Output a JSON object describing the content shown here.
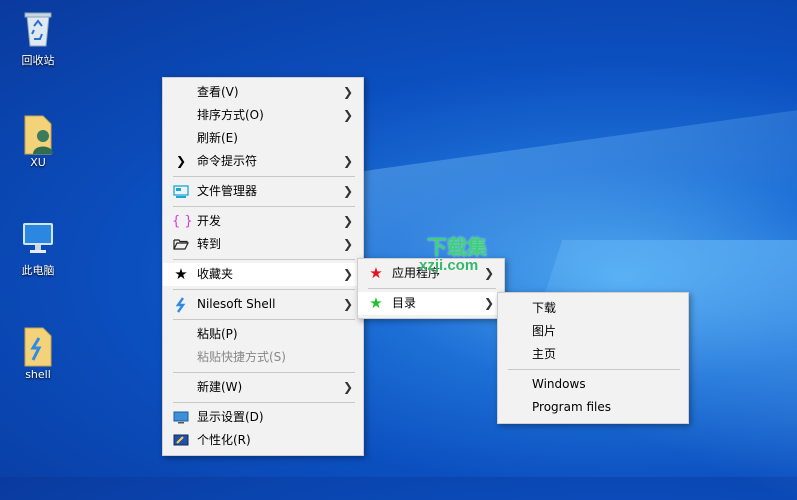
{
  "desktop": {
    "icons": [
      {
        "label": "回收站"
      },
      {
        "label": "XU"
      },
      {
        "label": "此电脑"
      },
      {
        "label": "shell"
      }
    ]
  },
  "context_menu": {
    "items": [
      {
        "label": "查看(V)",
        "submenu": true
      },
      {
        "label": "排序方式(O)",
        "submenu": true
      },
      {
        "label": "刷新(E)"
      },
      {
        "label": "命令提示符",
        "icon": "chevron-right-icon",
        "submenu": true
      },
      {
        "label": "文件管理器",
        "icon": "file-manager-icon",
        "submenu": true
      },
      {
        "label": "开发",
        "icon": "braces-icon",
        "submenu": true
      },
      {
        "label": "转到",
        "icon": "folder-open-icon",
        "submenu": true
      },
      {
        "label": "收藏夹",
        "icon": "star-icon",
        "submenu": true,
        "highlighted": true
      },
      {
        "label": "Nilesoft Shell",
        "icon": "nilesoft-icon",
        "submenu": true
      },
      {
        "label": "粘贴(P)"
      },
      {
        "label": "粘贴快捷方式(S)",
        "disabled": true
      },
      {
        "label": "新建(W)",
        "submenu": true
      },
      {
        "label": "显示设置(D)",
        "icon": "display-icon"
      },
      {
        "label": "个性化(R)",
        "icon": "personalize-icon"
      }
    ]
  },
  "favorites_menu": {
    "items": [
      {
        "label": "应用程序",
        "icon": "red-star-icon",
        "submenu": true
      },
      {
        "label": "目录",
        "icon": "green-star-icon",
        "submenu": true,
        "highlighted": true
      }
    ]
  },
  "directory_menu": {
    "items": [
      {
        "label": "下载"
      },
      {
        "label": "图片"
      },
      {
        "label": "主页"
      },
      {
        "label": "Windows"
      },
      {
        "label": "Program files"
      }
    ]
  },
  "watermark": {
    "line1": "下载集",
    "line2": "xzji.com"
  },
  "colors": {
    "menu_bg": "#f2f2f2",
    "highlight": "#ffffff",
    "desktop": "#0b4fbf",
    "red_star": "#e81123",
    "green_star": "#22c12e"
  }
}
